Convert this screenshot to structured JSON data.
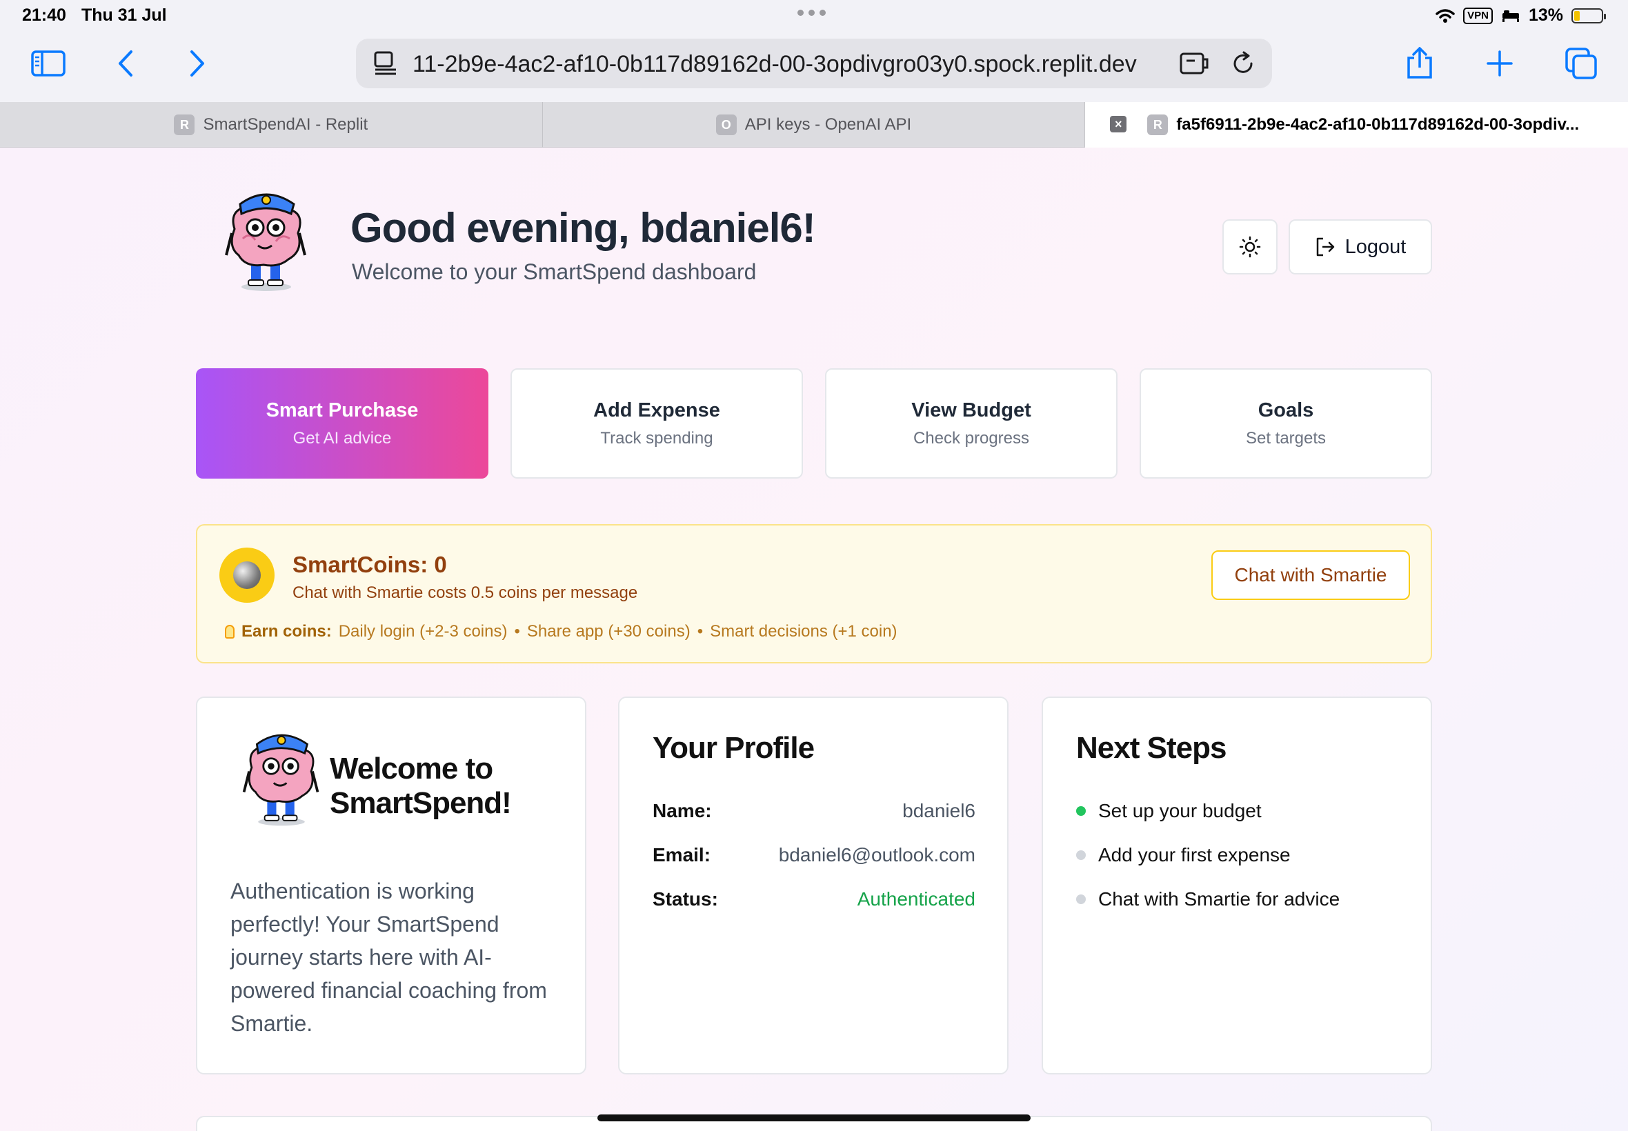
{
  "status_bar": {
    "time": "21:40",
    "date": "Thu 31 Jul",
    "vpn": "VPN",
    "battery": "13%"
  },
  "browser": {
    "url": "11-2b9e-4ac2-af10-0b117d89162d-00-3opdivgro03y0.spock.replit.dev",
    "tabs": [
      {
        "label": "SmartSpendAI - Replit",
        "favicon": "R"
      },
      {
        "label": "API keys - OpenAI API",
        "favicon": "O"
      },
      {
        "label": "fa5f6911-2b9e-4ac2-af10-0b117d89162d-00-3opdiv...",
        "favicon": "R"
      }
    ]
  },
  "header": {
    "greeting": "Good evening, bdaniel6!",
    "subtitle": "Welcome to your SmartSpend dashboard",
    "logout_label": "Logout"
  },
  "actions": [
    {
      "title": "Smart Purchase",
      "subtitle": "Get AI advice"
    },
    {
      "title": "Add Expense",
      "subtitle": "Track spending"
    },
    {
      "title": "View Budget",
      "subtitle": "Check progress"
    },
    {
      "title": "Goals",
      "subtitle": "Set targets"
    }
  ],
  "coins": {
    "title": "SmartCoins: 0",
    "subtitle": "Chat with Smartie costs 0.5 coins per message",
    "chat_button": "Chat with Smartie",
    "earn_label": "Earn coins:",
    "earn_items": [
      "Daily login (+2-3 coins)",
      "•",
      "Share app (+30 coins)",
      "•",
      "Smart decisions (+1 coin)"
    ]
  },
  "welcome_card": {
    "title": "Welcome to SmartSpend!",
    "body": "Authentication is working perfectly! Your SmartSpend journey starts here with AI-powered financial coaching from Smartie."
  },
  "profile": {
    "title": "Your Profile",
    "rows": [
      {
        "key": "Name:",
        "value": "bdaniel6"
      },
      {
        "key": "Email:",
        "value": "bdaniel6@outlook.com"
      },
      {
        "key": "Status:",
        "value": "Authenticated"
      }
    ]
  },
  "next_steps": {
    "title": "Next Steps",
    "items": [
      "Set up your budget",
      "Add your first expense",
      "Chat with Smartie for advice"
    ]
  },
  "colors": {
    "accent_start": "#a855f7",
    "accent_end": "#ec4899",
    "success": "#16a34a",
    "coin": "#facc15",
    "browser_blue": "#0a7aff"
  }
}
